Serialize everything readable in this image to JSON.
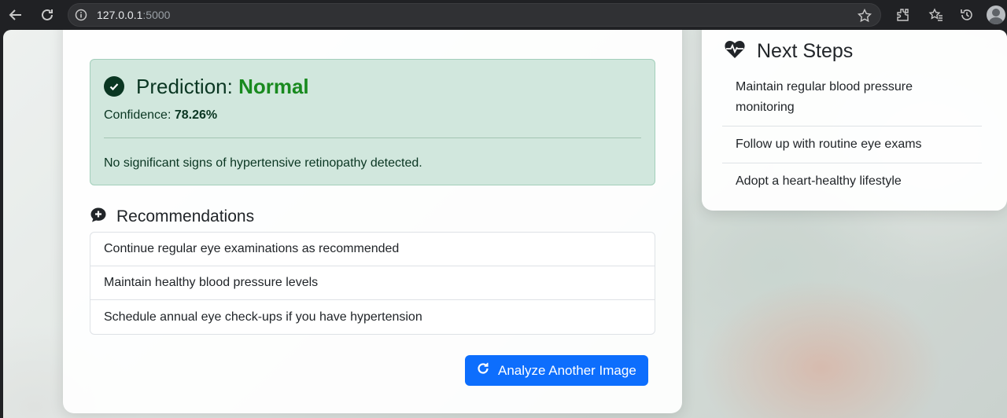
{
  "browser": {
    "url_host": "127.0.0.1",
    "url_port": ":5000"
  },
  "prediction": {
    "label": "Prediction: ",
    "value": "Normal",
    "confidence_label": "Confidence: ",
    "confidence_value": "78.26%",
    "message": "No significant signs of hypertensive retinopathy detected."
  },
  "recommendations": {
    "title": "Recommendations",
    "items": [
      "Continue regular eye examinations as recommended",
      "Maintain healthy blood pressure levels",
      "Schedule annual eye check-ups if you have hypertension"
    ]
  },
  "actions": {
    "analyze_label": "Analyze Another Image"
  },
  "next_steps": {
    "title": "Next Steps",
    "items": [
      "Maintain regular blood pressure monitoring",
      "Follow up with routine eye exams",
      "Adopt a heart-healthy lifestyle"
    ]
  },
  "colors": {
    "accent": "#0d6efd",
    "success_bg": "#d1e7dd",
    "success_text": "#0a3622",
    "prediction_value": "#198a1f"
  }
}
